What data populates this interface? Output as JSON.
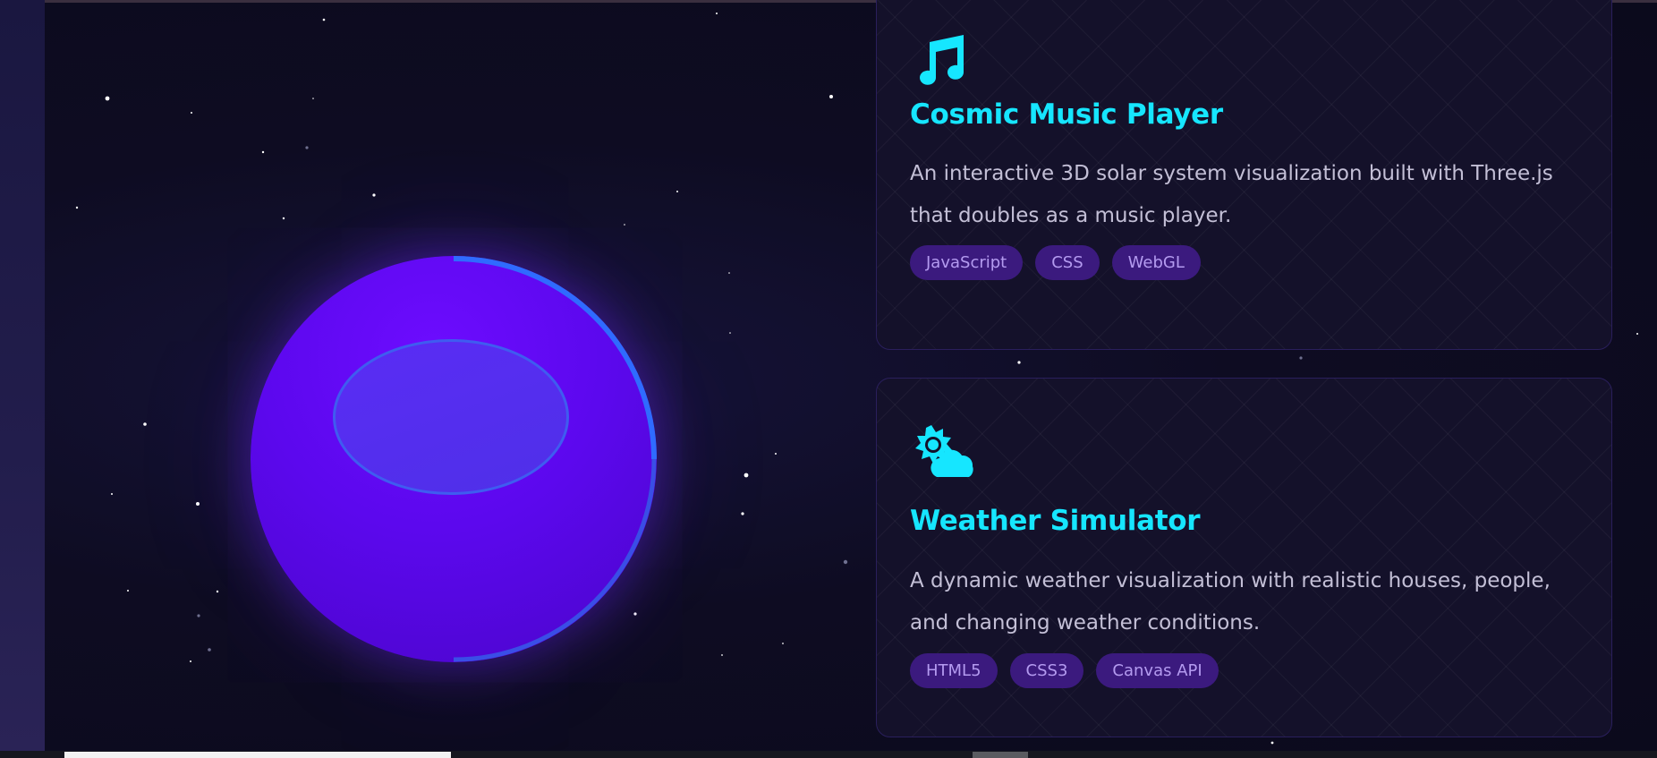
{
  "projects": [
    {
      "icon": "music-note-icon",
      "title": "Cosmic Music Player",
      "description": "An interactive 3D solar system visualization built with Three.js that doubles as a music player.",
      "tags": [
        "JavaScript",
        "CSS",
        "WebGL"
      ]
    },
    {
      "icon": "sun-cloud-icon",
      "title": "Weather Simulator",
      "description": "A dynamic weather visualization with realistic houses, people, and changing weather conditions.",
      "tags": [
        "HTML5",
        "CSS3",
        "Canvas API"
      ]
    }
  ],
  "colors": {
    "background": "#0d0b1e",
    "accent_cyan": "#16e6ff",
    "planet_purple": "#5c08ee",
    "ring_blue": "#2f6bff",
    "tag_bg": "#3b1a7e",
    "tag_text": "#b49bf0",
    "description_text": "#c3bfd6"
  }
}
